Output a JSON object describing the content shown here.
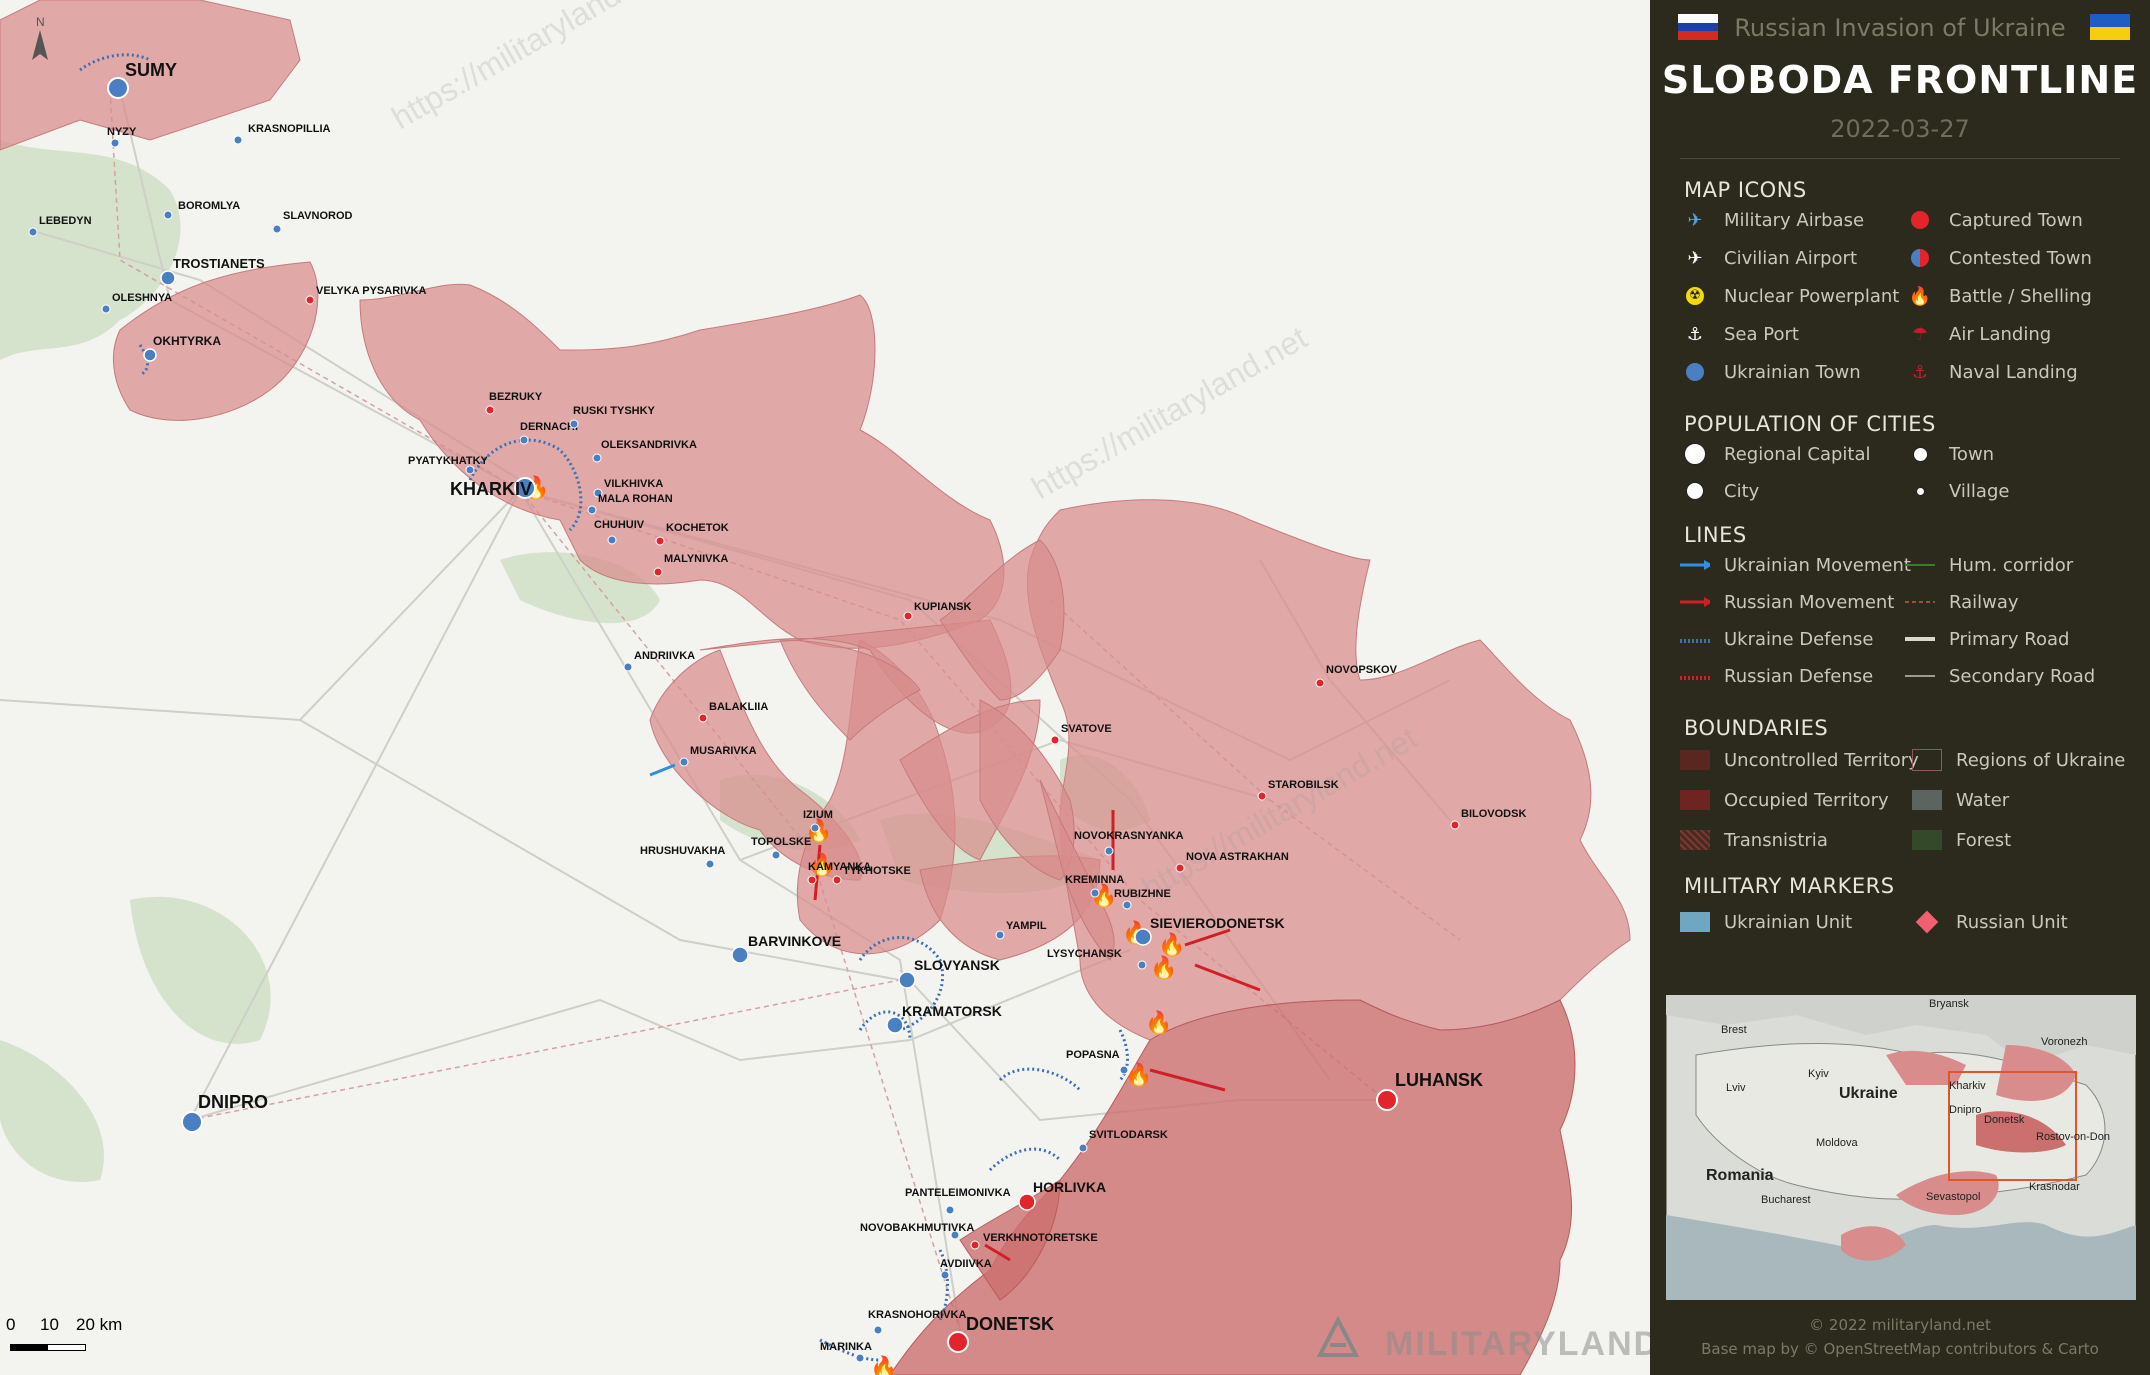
{
  "panel": {
    "title": "Russian Invasion of Ukraine",
    "heading": "SLOBODA FRONTLINE",
    "date": "2022-03-27",
    "sections": {
      "icons": "MAP ICONS",
      "population": "POPULATION OF CITIES",
      "lines": "LINES",
      "boundaries": "BOUNDARIES",
      "military": "MILITARY MARKERS"
    },
    "icons": [
      {
        "label": "Military Airbase",
        "icon": "airbase-icon",
        "color": "#5aa0d8"
      },
      {
        "label": "Civilian Airport",
        "icon": "airport-icon",
        "color": "#ffffff"
      },
      {
        "label": "Nuclear Powerplant",
        "icon": "nuclear-icon",
        "color": "#f5d90a"
      },
      {
        "label": "Sea Port",
        "icon": "anchor-icon",
        "color": "#ffffff"
      },
      {
        "label": "Ukrainian Town",
        "icon": "ukrainian-town-icon",
        "color": "#4a7fc1"
      },
      {
        "label": "Captured Town",
        "icon": "captured-town-icon",
        "color": "#e3242b"
      },
      {
        "label": "Contested Town",
        "icon": "contested-town-icon",
        "color": "#e3242b"
      },
      {
        "label": "Battle / Shelling",
        "icon": "fire-icon",
        "color": "#f28c28"
      },
      {
        "label": "Air Landing",
        "icon": "parachute-icon",
        "color": "#c0202a"
      },
      {
        "label": "Naval Landing",
        "icon": "naval-landing-icon",
        "color": "#c0202a"
      }
    ],
    "population": [
      {
        "label": "Regional Capital"
      },
      {
        "label": "City"
      },
      {
        "label": "Town"
      },
      {
        "label": "Village"
      }
    ],
    "lines": [
      {
        "label": "Ukrainian Movement",
        "color": "#2f8fe0"
      },
      {
        "label": "Russian Movement",
        "color": "#d01f27"
      },
      {
        "label": "Ukraine Defense",
        "color": "#3a6fb4"
      },
      {
        "label": "Russian Defense",
        "color": "#d01f27"
      },
      {
        "label": "Hum. corridor",
        "color": "#3e7a2e"
      },
      {
        "label": "Railway",
        "color": "#9a5040"
      },
      {
        "label": "Primary Road",
        "color": "#d8d8d0"
      },
      {
        "label": "Secondary Road",
        "color": "#9a9a90"
      }
    ],
    "boundaries": [
      {
        "label": "Uncontrolled Territory",
        "color": "#5a2620"
      },
      {
        "label": "Occupied Territory",
        "color": "#6e2420"
      },
      {
        "label": "Transnistria",
        "color": "#4a2a22"
      },
      {
        "label": "Regions of Ukraine",
        "color": "#3a2e24"
      },
      {
        "label": "Water",
        "color": "#5c6460"
      },
      {
        "label": "Forest",
        "color": "#34482a"
      }
    ],
    "military": [
      {
        "label": "Ukrainian Unit",
        "color": "#6fa6c0"
      },
      {
        "label": "Russian Unit",
        "color": "#f06070"
      }
    ],
    "copyright": "© 2022 militaryland.net",
    "basemap": "Base map by © OpenStreetMap contributors & Carto"
  },
  "map": {
    "cities": [
      {
        "name": "SUMY"
      },
      {
        "name": "KHARKIV"
      },
      {
        "name": "DNIPRO"
      },
      {
        "name": "LUHANSK"
      },
      {
        "name": "DONETSK"
      }
    ],
    "towns": [
      {
        "name": "TROSTIANETS"
      },
      {
        "name": "OKHTYRKA"
      },
      {
        "name": "BARVINKOVE"
      },
      {
        "name": "SLOVYANSK"
      },
      {
        "name": "KRAMATORSK"
      },
      {
        "name": "SIEVIERODONETSK"
      },
      {
        "name": "HORLIVKA"
      }
    ],
    "villages": [
      {
        "name": "NYZY"
      },
      {
        "name": "KRASNOPILLIA"
      },
      {
        "name": "BOROMLYA"
      },
      {
        "name": "SLAVNOROD"
      },
      {
        "name": "LEBEDYN"
      },
      {
        "name": "OLESHNYA"
      },
      {
        "name": "VELYKA PYSARIVKA"
      },
      {
        "name": "BEZRUKY"
      },
      {
        "name": "DERNACHI"
      },
      {
        "name": "RUSKI TYSHKY"
      },
      {
        "name": "OLEKSANDRIVKA"
      },
      {
        "name": "PYATYKHATKY"
      },
      {
        "name": "VILKHIVKA"
      },
      {
        "name": "MALA ROHAN"
      },
      {
        "name": "KOCHETOK"
      },
      {
        "name": "CHUHUIV"
      },
      {
        "name": "MALYNIVKA"
      },
      {
        "name": "KUPIANSK"
      },
      {
        "name": "ANDRIIVKA"
      },
      {
        "name": "BALAKLIIA"
      },
      {
        "name": "NOVOPSKOV"
      },
      {
        "name": "SVATOVE"
      },
      {
        "name": "MUSARIVKA"
      },
      {
        "name": "STAROBILSK"
      },
      {
        "name": "BILOVODSK"
      },
      {
        "name": "IZIUM"
      },
      {
        "name": "TOPOLSKE"
      },
      {
        "name": "HRUSHUVAKHA"
      },
      {
        "name": "KAMYANKA"
      },
      {
        "name": "TYKHOTSKE"
      },
      {
        "name": "NOVOKRASNYANKA"
      },
      {
        "name": "NOVA ASTRAKHAN"
      },
      {
        "name": "KREMINNA"
      },
      {
        "name": "RUBIZHNE"
      },
      {
        "name": "YAMPIL"
      },
      {
        "name": "LYSYCHANSK"
      },
      {
        "name": "POPASNA"
      },
      {
        "name": "SVITLODARSK"
      },
      {
        "name": "PANTELEIMONIVKA"
      },
      {
        "name": "VERKHNOTORETSKE"
      },
      {
        "name": "NOVOBAKHMUTIVKA"
      },
      {
        "name": "AVDIIVKA"
      },
      {
        "name": "KRASNOHORIVKA"
      },
      {
        "name": "MARINKA"
      }
    ],
    "watermark": "https://militaryland.net",
    "logo": "MILITARYLAND",
    "scale": {
      "labels": [
        "0",
        "10",
        "20 km"
      ]
    },
    "north": "N",
    "colors": {
      "occupied": "#d88c8c",
      "occupied_dark": "#cc6f6f",
      "ukr": "#4a7fc1",
      "rus": "#e3242b",
      "background": "#f2f2ef",
      "forest": "#c9dcc0"
    }
  },
  "inset": {
    "labels": [
      "Bryansk",
      "Brest",
      "Voronezh",
      "Kyiv",
      "Lviv",
      "Ukraine",
      "Kharkiv",
      "Dnipro",
      "Donetsk",
      "Rostov-on-Don",
      "Moldova",
      "Romania",
      "Bucharest",
      "Krasnodar",
      "Sevastopol"
    ]
  }
}
